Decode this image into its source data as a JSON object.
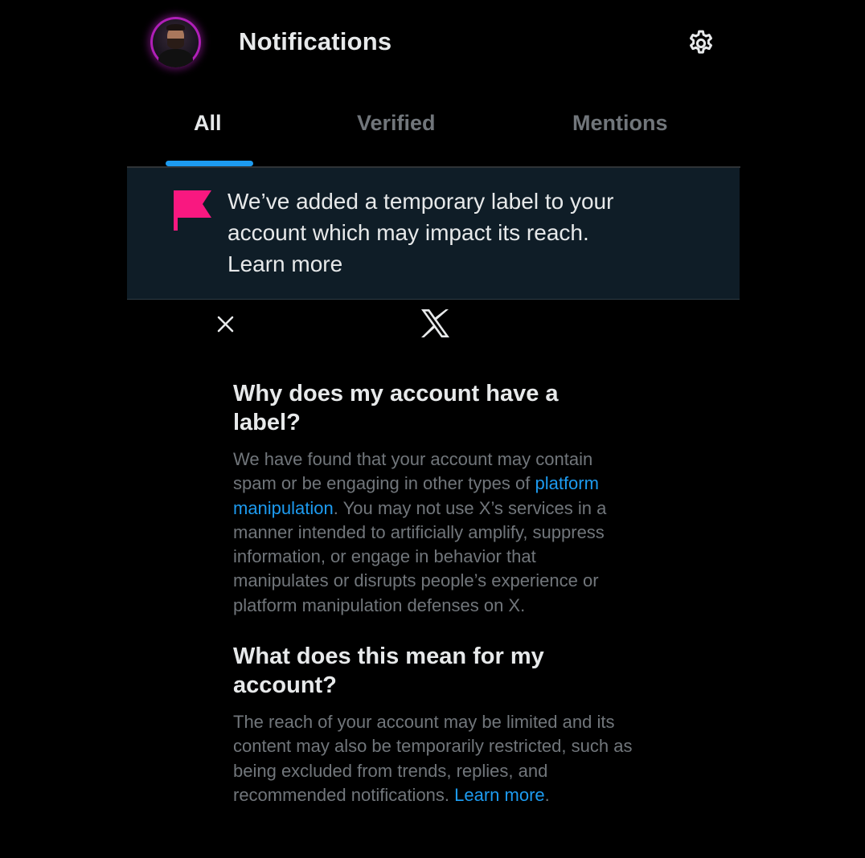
{
  "header": {
    "title": "Notifications",
    "avatar_icon": "user-avatar",
    "settings_icon": "gear-icon"
  },
  "tabs": [
    {
      "label": "All",
      "active": true
    },
    {
      "label": "Verified",
      "active": false
    },
    {
      "label": "Mentions",
      "active": false
    }
  ],
  "banner": {
    "icon": "flag-icon",
    "icon_color": "#f91880",
    "line1": "We’ve added a temporary label to your",
    "line2": "account which may impact its reach.",
    "link": "Learn more"
  },
  "sheet": {
    "close_icon": "close-icon",
    "logo_icon": "x-logo-icon"
  },
  "section1": {
    "heading_line1": "Why does my account have a",
    "heading_line2": "label?",
    "text_before_link": "We have found that your account may contain spam or be engaging in other types of ",
    "link": "platform manipulation",
    "text_after_link": ". You may not use X’s services in a manner intended to artificially amplify, suppress information, or engage in behavior that manipulates or disrupts people’s experience or platform manipulation defenses on X."
  },
  "section2": {
    "heading_line1": "What does this mean for my",
    "heading_line2": "account?",
    "text_before_link": "The reach of your account may be limited and its content may also be temporarily restricted, such as being excluded from trends, replies, and recommended notifications. ",
    "link": "Learn more",
    "text_after_link": "."
  },
  "colors": {
    "background": "#000000",
    "accent": "#1d9bf0",
    "banner_bg": "#0f1d27",
    "muted_text": "#71767b"
  }
}
